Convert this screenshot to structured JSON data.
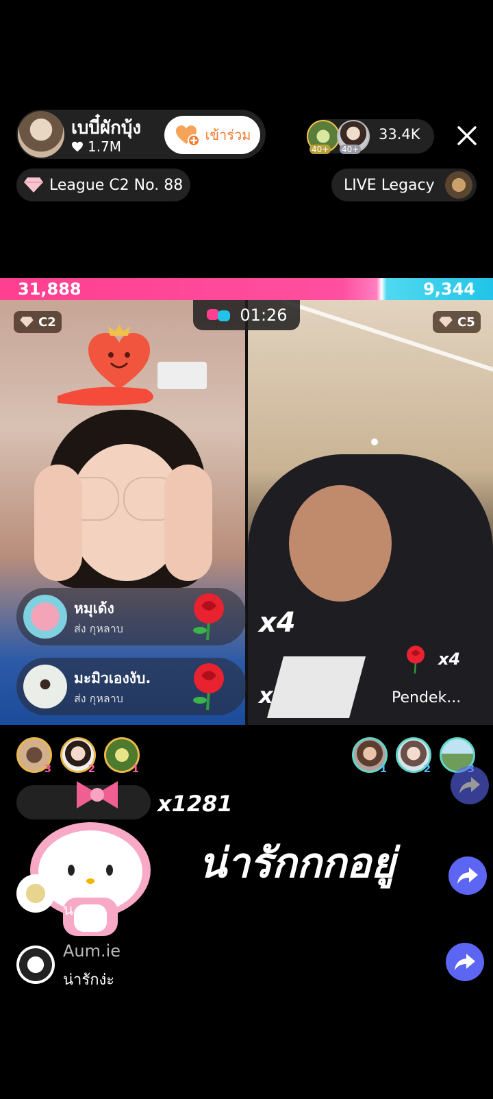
{
  "host": {
    "name": "เบบี๋ผักบุ้ง",
    "likes": "1.7M",
    "join_label": "เข้าร่วม",
    "league": "League C2 No. 88"
  },
  "viewers": {
    "badges": [
      "40+",
      "40+"
    ],
    "count": "33.4K"
  },
  "legacy_label": "LIVE Legacy",
  "battle": {
    "left_score": "31,888",
    "right_score": "9,344",
    "left_share": 0.774,
    "timer": "01:26",
    "left_rank": "C2",
    "right_rank": "C5"
  },
  "gifts": [
    {
      "name": "หมุเด้ง",
      "sub": "ส่ง กุหลาบ"
    },
    {
      "name": "มะมิวเองงับ.",
      "sub": "ส่ง กุหลาบ"
    }
  ],
  "left_combo": "x4",
  "left_combo2": "x",
  "right_gift": {
    "count": "x4",
    "name": "Pendek..."
  },
  "left_supporters": [
    "3",
    "2",
    "1"
  ],
  "right_supporters": [
    "1",
    "2",
    "3"
  ],
  "sticker_combo": "x1281",
  "overlay_text": "น่ารักกกอยู่",
  "partial_comment": "น",
  "comments": [
    {
      "user": "Aum.ie",
      "text": "น่ารักง่ะ"
    }
  ],
  "colors": {
    "left_team": "#ff3f8f",
    "right_team": "#21c4e8",
    "share_button": "#5d66f2",
    "join_text": "#f2792c"
  },
  "icons": [
    "heart-icon",
    "diamond-icon",
    "close-icon",
    "gloves-icon",
    "rose-icon",
    "share-icon",
    "hello-kitty-sticker"
  ]
}
